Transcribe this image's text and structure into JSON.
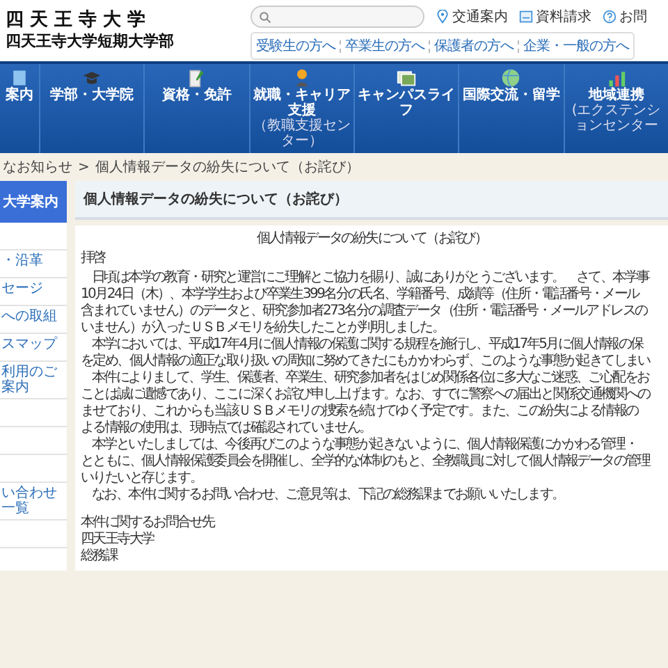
{
  "header": {
    "logo_line_1": "四 天 王 寺 大 学",
    "logo_line_2": "四天王寺大学短期大学部",
    "links": [
      "交通案内",
      "資料請求",
      "お問"
    ],
    "audience_tabs": [
      "受験生の方へ",
      "卒業生の方へ",
      "保護者の方へ",
      "企業・一般の方へ"
    ]
  },
  "nav": [
    {
      "label": "案内"
    },
    {
      "label": "学部・大学院"
    },
    {
      "label": "資格・免許"
    },
    {
      "label": "就職・キャリア支援",
      "sub": "（教職支援センター）"
    },
    {
      "label": "キャンパスライフ"
    },
    {
      "label": "国際交流・留学"
    },
    {
      "label": "地域連携",
      "sub": "(エクステンションセンター"
    }
  ],
  "breadcrumb": {
    "link": "なお知らせ",
    "separator": ">",
    "current": "個人情報データの紛失について（お詫び）"
  },
  "sidebar": {
    "title": "大学案内",
    "items": [
      {
        "kind": "blank"
      },
      {
        "kind": "link",
        "label": "・沿革"
      },
      {
        "kind": "link",
        "label": "セージ"
      },
      {
        "kind": "link",
        "label": "への取組"
      },
      {
        "kind": "link",
        "label": "スマップ"
      },
      {
        "kind": "link",
        "label": "利用のご案内"
      },
      {
        "kind": "blank"
      },
      {
        "kind": "blank"
      },
      {
        "kind": "blank"
      },
      {
        "kind": "link",
        "label": "い合わせ一覧"
      },
      {
        "kind": "blank"
      }
    ]
  },
  "article": {
    "heading": "個人情報データの紛失について（お詫び）",
    "title": "個人情報データの紛失について（お詫び）",
    "greeting": "拝啓",
    "lines": [
      {
        "text": "日頃は本学の教育・研究と運営にご理解とご協力を賜り、誠にありがとうございます。　さて、本学事",
        "indent": true
      },
      {
        "text": "10月24日（木）、本学学生および卒業生399名分の氏名、学籍番号、成績等（住所・電話番号・メール",
        "indent": false
      },
      {
        "text": "含まれていません）のデータと、研究参加者273名分の調査データ（住所・電話番号・メールアドレスの",
        "indent": false
      },
      {
        "text": "いません）が入ったＵＳＢメモリを紛失したことが判明しました。",
        "indent": false
      },
      {
        "text": "本学においては、平成17年4月に個人情報の保護に関する規程を施行し、平成17年5月に個人情報の保",
        "indent": true
      },
      {
        "text": "を定め、個人情報の適正な取り扱いの周知に努めてきたにもかかわらず、このような事態が起きてしまい",
        "indent": false
      },
      {
        "text": "本件によりまして、学生、保護者、卒業生、研究参加者をはじめ関係各位に多大なご迷惑、ご心配をお",
        "indent": true
      },
      {
        "text": "ことは誠に遺憾であり、ここに深くお詫び申し上げます。なお、すでに警察への届出と関係交通機関への",
        "indent": false
      },
      {
        "text": "ませており、これからも当該ＵＳＢメモリの捜索を続けてゆく予定です。また、この紛失による情報の",
        "indent": false
      },
      {
        "text": "よる情報の使用は、現時点では確認されていません。",
        "indent": false
      },
      {
        "text": "本学といたしましては、今後再びこのような事態が起きないように、個人情報保護にかかわる管理・",
        "indent": true
      },
      {
        "text": "とともに、個人情報保護委員会を開催し、全学的な体制のもと、全教職員に対して個人情報データの管理",
        "indent": false
      },
      {
        "text": "いりたいと存じます。",
        "indent": false
      },
      {
        "text": "なお、本件に関するお問い合わせ、ご意見等は、下記の総務課までお願いいたします。",
        "indent": true
      }
    ],
    "contact": [
      "本件に関するお問合せ先",
      "四天王寺大学",
      "総務課"
    ]
  }
}
